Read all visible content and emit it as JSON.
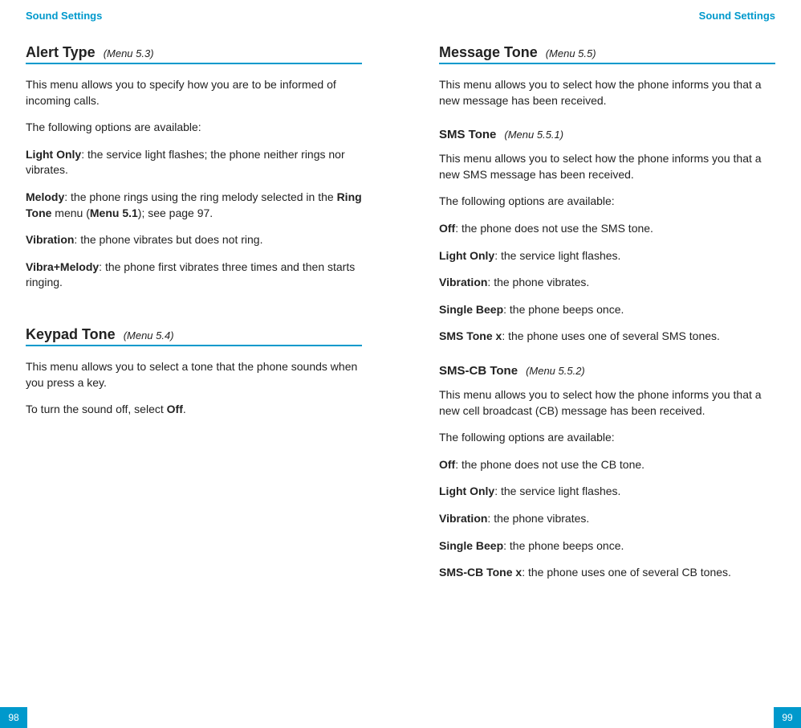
{
  "left": {
    "header": "Sound Settings",
    "pageNumber": "98",
    "sections": [
      {
        "title": "Alert Type",
        "menu": "(Menu 5.3)",
        "intro1": "This menu allows you to specify how you are to be informed of incoming calls.",
        "intro2": "The following options are available:",
        "opt1_label": "Light Only",
        "opt1_desc": ": the service light flashes; the phone neither rings nor vibrates.",
        "opt2_label": "Melody",
        "opt2_desc_a": ": the phone rings using the ring melody selected in the ",
        "opt2_ringtone": "Ring Tone",
        "opt2_desc_b": " menu (",
        "opt2_menu51": "Menu 5.1",
        "opt2_desc_c": "); see page 97.",
        "opt3_label": "Vibration",
        "opt3_desc": ": the phone vibrates but does not ring.",
        "opt4_label": "Vibra+Melody",
        "opt4_desc": ": the phone first vibrates three times and then starts ringing."
      },
      {
        "title": "Keypad Tone",
        "menu": "(Menu 5.4)",
        "intro1": "This menu allows you to select a tone that the phone sounds when you press a key.",
        "intro2_a": "To turn the sound off, select ",
        "intro2_off": "Off",
        "intro2_b": "."
      }
    ]
  },
  "right": {
    "header": "Sound Settings",
    "pageNumber": "99",
    "section": {
      "title": "Message Tone",
      "menu": "(Menu 5.5)",
      "intro": "This menu allows you to select how the phone informs you that a new message has been received.",
      "sub1": {
        "title": "SMS Tone",
        "menu": "(Menu 5.5.1)",
        "intro1": "This menu allows you to select how the phone informs you that a new SMS message has been received.",
        "intro2": "The following options are available:",
        "opt1_label": "Off",
        "opt1_desc": ": the phone does not use the SMS tone.",
        "opt2_label": "Light Only",
        "opt2_desc": ": the service light flashes.",
        "opt3_label": "Vibration",
        "opt3_desc": ": the phone vibrates.",
        "opt4_label": "Single Beep",
        "opt4_desc": ": the phone beeps once.",
        "opt5_label": "SMS Tone x",
        "opt5_desc": ": the phone uses one of several SMS tones."
      },
      "sub2": {
        "title": "SMS-CB Tone",
        "menu": "(Menu 5.5.2)",
        "intro1": "This menu allows you to select how the phone informs you that a new cell broadcast (CB) message has been received.",
        "intro2": "The following options are available:",
        "opt1_label": "Off",
        "opt1_desc": ": the phone does not use the CB tone.",
        "opt2_label": "Light Only",
        "opt2_desc": ": the service light flashes.",
        "opt3_label": "Vibration",
        "opt3_desc": ": the phone vibrates.",
        "opt4_label": "Single Beep",
        "opt4_desc": ": the phone beeps once.",
        "opt5_label": "SMS-CB Tone x",
        "opt5_desc": ": the phone uses one of several CB tones."
      }
    }
  }
}
